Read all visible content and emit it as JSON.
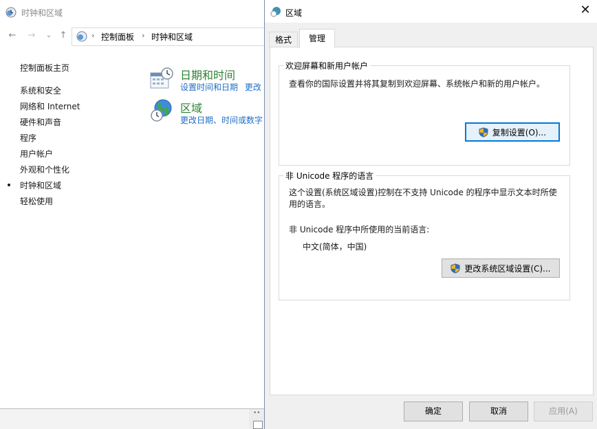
{
  "control_panel": {
    "window_title": "时钟和区域",
    "breadcrumb": [
      "控制面板",
      "时钟和区域"
    ],
    "sidebar": [
      {
        "label": "控制面板主页"
      },
      {
        "label": "系统和安全"
      },
      {
        "label": "网络和 Internet"
      },
      {
        "label": "硬件和声音"
      },
      {
        "label": "程序"
      },
      {
        "label": "用户帐户"
      },
      {
        "label": "外观和个性化"
      },
      {
        "label": "时钟和区域",
        "current": true
      },
      {
        "label": "轻松使用"
      }
    ],
    "categories": [
      {
        "title": "日期和时间",
        "links": [
          "设置时间和日期",
          "更改"
        ]
      },
      {
        "title": "区域",
        "links": [
          "更改日期、时间或数字"
        ]
      }
    ]
  },
  "dialog": {
    "title": "区域",
    "tabs": [
      "格式",
      "管理"
    ],
    "active_tab": "管理",
    "welcome_group": {
      "legend": "欢迎屏幕和新用户帐户",
      "description": "查看你的国际设置并将其复制到欢迎屏幕、系统帐户和新的用户帐户。",
      "button": "复制设置(O)..."
    },
    "unicode_group": {
      "legend": "非 Unicode 程序的语言",
      "description": "这个设置(系统区域设置)控制在不支持 Unicode 的程序中显示文本时所使用的语言。",
      "current_label": "非 Unicode 程序中所使用的当前语言:",
      "current_value": "中文(简体，中国)",
      "button": "更改系统区域设置(C)..."
    },
    "footer": {
      "ok": "确定",
      "cancel": "取消",
      "apply": "应用(A)"
    }
  },
  "colors": {
    "category_title": "#2c8232",
    "link": "#1f6cc6",
    "focus": "#0078d7"
  }
}
